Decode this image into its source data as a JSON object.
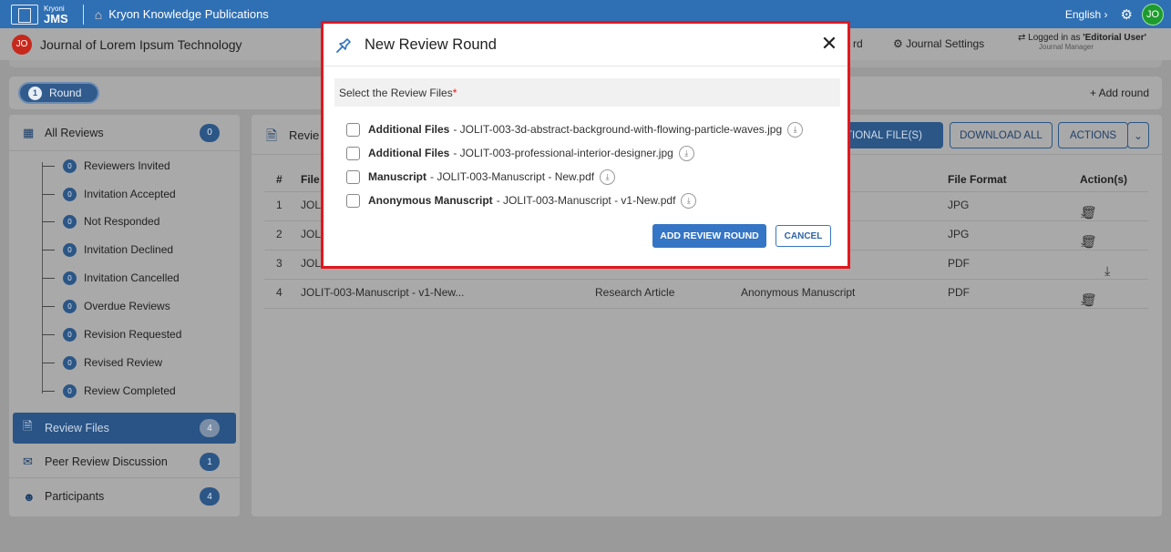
{
  "topbar": {
    "logo_small": "Kryoni",
    "logo_big": "JMS",
    "publication": "Kryon Knowledge Publications",
    "language": "English ›",
    "avatar": "JO"
  },
  "journalbar": {
    "avatar": "JO",
    "journal_title": "Journal of Lorem Ipsum Technology",
    "dashboard_partial": "rd",
    "settings": "Journal Settings",
    "logged_in_prefix": "Logged in as ",
    "logged_in_role": "'Editorial User'",
    "logged_in_sub": "Journal Manager"
  },
  "round": {
    "number": "1",
    "label": "Round",
    "add_label": "+ Add round"
  },
  "sidebar": {
    "all_reviews": {
      "label": "All Reviews",
      "count": "0"
    },
    "sub_items": [
      {
        "label": "Reviewers Invited",
        "count": "0"
      },
      {
        "label": "Invitation Accepted",
        "count": "0"
      },
      {
        "label": "Not Responded",
        "count": "0"
      },
      {
        "label": "Invitation Declined",
        "count": "0"
      },
      {
        "label": "Invitation Cancelled",
        "count": "0"
      },
      {
        "label": "Overdue Reviews",
        "count": "0"
      },
      {
        "label": "Revision Requested",
        "count": "0"
      },
      {
        "label": "Revised Review",
        "count": "0"
      },
      {
        "label": "Review Completed",
        "count": "0"
      }
    ],
    "review_files": {
      "label": "Review Files",
      "count": "4"
    },
    "peer_review": {
      "label": "Peer Review Discussion",
      "count": "1"
    },
    "participants": {
      "label": "Participants",
      "count": "4"
    }
  },
  "main": {
    "title_partial": "Revie",
    "add_files_partial": "TIONAL FILE(S)",
    "download_all": "DOWNLOAD ALL",
    "actions": "ACTIONS",
    "columns": {
      "num": "#",
      "file": "File",
      "format": "File Format",
      "action": "Action(s)"
    },
    "rows": [
      {
        "num": "1",
        "file": "JOL",
        "type": "",
        "component": "",
        "format": "JPG"
      },
      {
        "num": "2",
        "file": "JOL",
        "type": "",
        "component": "",
        "format": "JPG"
      },
      {
        "num": "3",
        "file": "JOL",
        "type": "",
        "component": "",
        "format": "PDF"
      },
      {
        "num": "4",
        "file": "JOLIT-003-Manuscript - v1-New...",
        "type": "Research Article",
        "component": "Anonymous Manuscript",
        "format": "PDF"
      }
    ]
  },
  "modal": {
    "title": "New Review Round",
    "section_label": "Select the Review Files",
    "required_mark": "*",
    "files": [
      {
        "type": "Additional Files",
        "name": "- JOLIT-003-3d-abstract-background-with-flowing-particle-waves.jpg"
      },
      {
        "type": "Additional Files",
        "name": "- JOLIT-003-professional-interior-designer.jpg"
      },
      {
        "type": "Manuscript",
        "name": "- JOLIT-003-Manuscript - New.pdf"
      },
      {
        "type": "Anonymous Manuscript",
        "name": "- JOLIT-003-Manuscript - v1-New.pdf"
      }
    ],
    "add_button": "ADD REVIEW ROUND",
    "cancel_button": "CANCEL"
  }
}
